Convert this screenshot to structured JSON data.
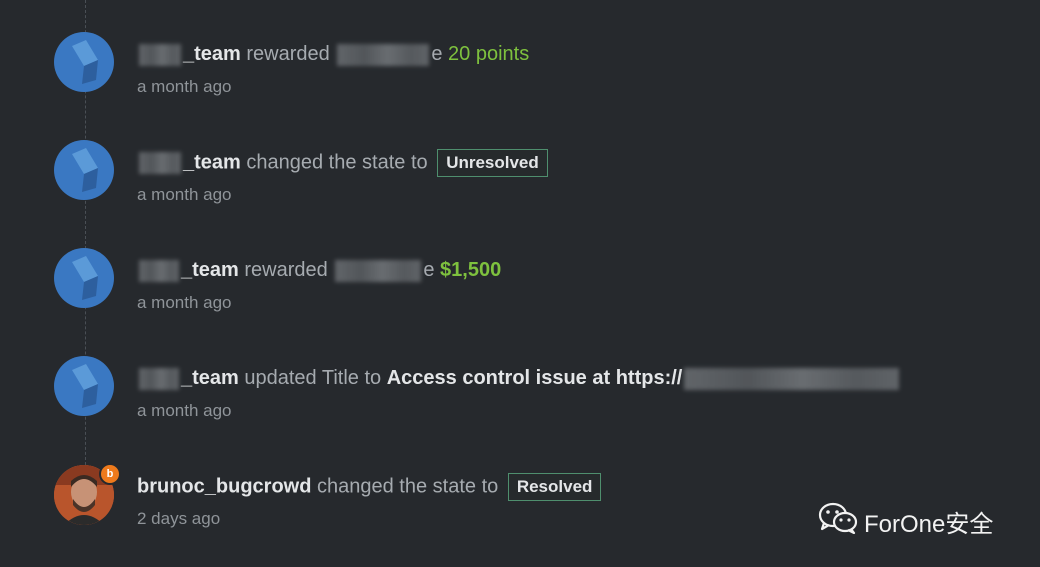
{
  "activities": [
    {
      "user": "_team",
      "action": "rewarded",
      "target_suffix": "e",
      "value": "20 points",
      "time": "a month ago"
    },
    {
      "user": "_team",
      "action": "changed the state to",
      "value": "Unresolved",
      "time": "a month ago"
    },
    {
      "user": "_team",
      "action": "rewarded",
      "target_suffix": "e",
      "value": "$1,500",
      "time": "a month ago"
    },
    {
      "user": "_team",
      "action": "updated Title to",
      "value": "Access control issue at https://",
      "time": "a month ago"
    },
    {
      "user": "brunoc_bugcrowd",
      "action": "changed the state to",
      "value": "Resolved",
      "time": "2 days ago",
      "avatar_badge": "b"
    }
  ],
  "watermark": {
    "text": "ForOne安全",
    "icon": "wechat-icon"
  },
  "colors": {
    "background": "#26292d",
    "avatar_blue": "#3a78c2",
    "green": "#7ec13e",
    "badge_border": "#4f8f6e"
  }
}
